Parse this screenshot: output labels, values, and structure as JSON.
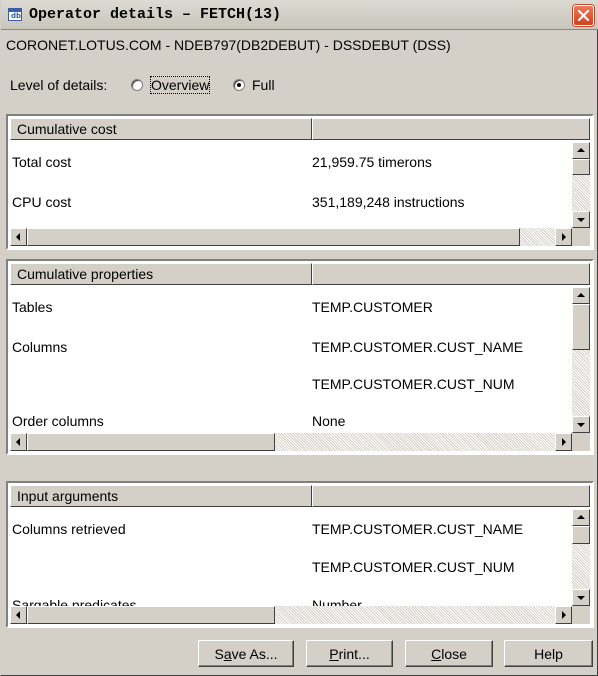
{
  "window": {
    "title": "Operator details – FETCH(13)",
    "icon_text": "db"
  },
  "connection": "CORONET.LOTUS.COM - NDEB797(DB2DEBUT) - DSSDEBUT (DSS)",
  "level": {
    "label": "Level of details:",
    "options": [
      "Overview",
      "Full"
    ],
    "selected": "Full"
  },
  "panels": [
    {
      "header": "Cumulative cost",
      "rows": [
        {
          "key": "Total cost",
          "value": "21,959.75 timerons"
        },
        {
          "key": "CPU cost",
          "value": "351,189,248 instructions"
        }
      ]
    },
    {
      "header": "Cumulative properties",
      "rows": [
        {
          "key": "Tables",
          "value": "TEMP.CUSTOMER"
        },
        {
          "key": "Columns",
          "value": "TEMP.CUSTOMER.CUST_NAME"
        },
        {
          "key": "",
          "value": "TEMP.CUSTOMER.CUST_NUM"
        },
        {
          "key": "Order columns",
          "value": "None"
        }
      ]
    },
    {
      "header": "Input arguments",
      "rows": [
        {
          "key": "Columns retrieved",
          "value": "TEMP.CUSTOMER.CUST_NAME"
        },
        {
          "key": "",
          "value": "TEMP.CUSTOMER.CUST_NUM"
        },
        {
          "key": "Sargable predicates",
          "value": "Number"
        }
      ]
    }
  ],
  "buttons": {
    "save_as": {
      "pre": "S",
      "u": "a",
      "post": "ve As..."
    },
    "print": {
      "pre": "",
      "u": "P",
      "post": "rint..."
    },
    "close": {
      "pre": "",
      "u": "C",
      "post": "lose"
    },
    "help": {
      "pre": "",
      "u": "",
      "post": "Help"
    }
  },
  "colors": {
    "close_button": "#d2401d",
    "dialog_bg": "#d4d0c8"
  },
  "icons": {
    "title": "window-icon",
    "close": "close-x-icon",
    "scroll_up": "arrow-up-icon",
    "scroll_down": "arrow-down-icon",
    "scroll_left": "arrow-left-icon",
    "scroll_right": "arrow-right-icon"
  }
}
